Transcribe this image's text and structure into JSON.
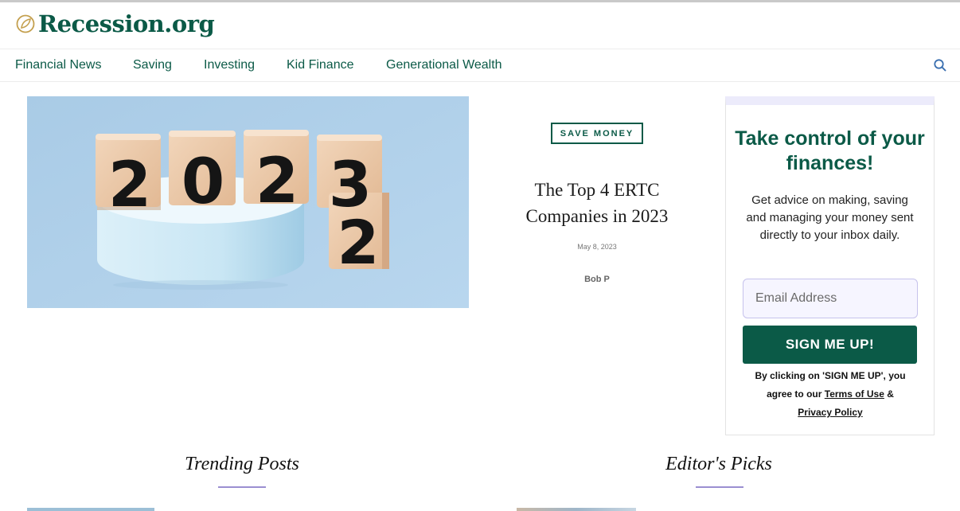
{
  "brand": {
    "name": "Recession.org",
    "logo_icon": "leaf-icon",
    "accent_color": "#0b5a47",
    "logo_color": "#c4a04f"
  },
  "nav": {
    "items": [
      "Financial News",
      "Saving",
      "Investing",
      "Kid Finance",
      "Generational Wealth"
    ],
    "search_icon": "search-icon"
  },
  "featured": {
    "category": "SAVE MONEY",
    "title": "The Top 4 ERTC Companies in 2023",
    "date": "May 8, 2023",
    "author": "Bob P",
    "image": {
      "blocks_top": [
        "2",
        "0",
        "2",
        "3"
      ],
      "block_bottom": "2"
    }
  },
  "signup": {
    "title": "Take control of your finances!",
    "description": "Get advice on making, saving and managing your money sent directly to your inbox daily.",
    "email_placeholder": "Email Address",
    "button_label": "SIGN ME UP!",
    "legal_prefix": "By clicking on 'SIGN ME UP', you agree to our",
    "terms_label": "Terms of Use",
    "legal_and": "&",
    "privacy_label": "Privacy Policy"
  },
  "sections": {
    "trending_title": "Trending Posts",
    "editors_title": "Editor's Picks"
  }
}
